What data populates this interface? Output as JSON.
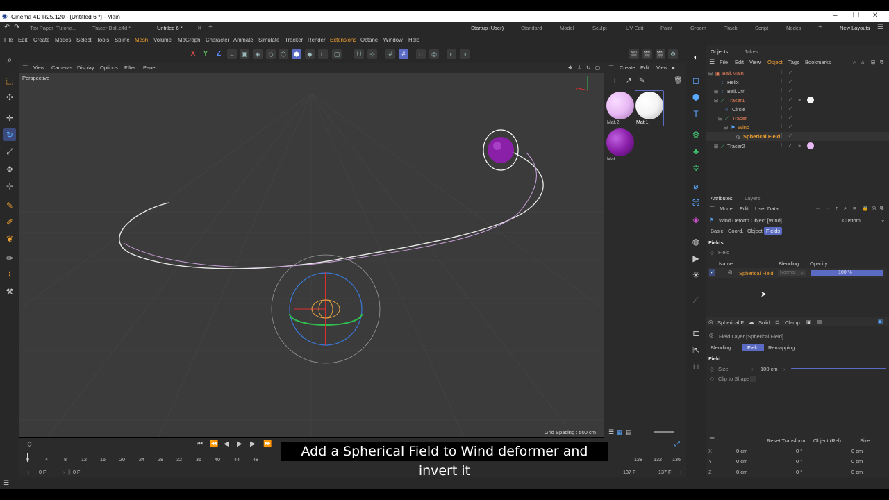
{
  "app": {
    "title": "Cinema 4D R25.120 - [Untitled 6 *] - Main",
    "tabs": [
      "Tax Paper_Tutoria...",
      "Tracer Ball.c4d *",
      "Untitled 6 *"
    ],
    "layouts": [
      "Startup (User)",
      "Standard",
      "Model",
      "Sculpt",
      "UV Edit",
      "Paint",
      "Groom",
      "Track",
      "Script",
      "Nodes"
    ],
    "new_layouts": "New Layouts"
  },
  "menu": [
    "File",
    "Edit",
    "Create",
    "Modes",
    "Select",
    "Tools",
    "Spline",
    "Mesh",
    "Volume",
    "MoGraph",
    "Character",
    "Animate",
    "Simulate",
    "Tracker",
    "Render",
    "Extensions",
    "Octane",
    "Window",
    "Help"
  ],
  "toolbar": {
    "axis_x": "X",
    "axis_y": "Y",
    "axis_z": "Z"
  },
  "viewport": {
    "menu": [
      "View",
      "Cameras",
      "Display",
      "Options",
      "Filter",
      "Panel"
    ],
    "label": "Perspective",
    "grid_spacing": "Grid Spacing : 500 cm"
  },
  "materials": {
    "menu": [
      "Create",
      "Edit",
      "View"
    ],
    "items": [
      {
        "name": "Mat.2",
        "color": "#e8b8f4"
      },
      {
        "name": "Mat.1",
        "color": "#f4f4f4"
      },
      {
        "name": "Mat",
        "color": "#8a1fa8"
      }
    ]
  },
  "objects": {
    "tabs": [
      "Objects",
      "Takes"
    ],
    "menu": [
      "File",
      "Edit",
      "View",
      "Object",
      "Tags",
      "Bookmarks"
    ],
    "rows": [
      {
        "name": "Ball.Main",
        "color": "#e87f5a"
      },
      {
        "name": "Helix",
        "color": "#c8c8c8"
      },
      {
        "name": "Ball.Ctrl",
        "color": "#c8c8c8"
      },
      {
        "name": "Tracer1",
        "color": "#e87f5a"
      },
      {
        "name": "Circle",
        "color": "#c8c8c8"
      },
      {
        "name": "Tracer",
        "color": "#e87f5a"
      },
      {
        "name": "Wind",
        "color": "#f0a030"
      },
      {
        "name": "Spherical Field",
        "color": "#f0a030"
      },
      {
        "name": "Tracer2",
        "color": "#c8c8c8"
      }
    ]
  },
  "attributes": {
    "tabs": [
      "Attributes",
      "Layers"
    ],
    "menu": [
      "Mode",
      "Edit",
      "User Data"
    ],
    "object_title": "Wind Deform Object [Wind]",
    "preset": "Custom",
    "subtabs": [
      "Basic",
      "Coord.",
      "Object",
      "Fields"
    ],
    "section": "Fields",
    "subsection": "Field",
    "columns": [
      "Name",
      "Blending",
      "Opacity"
    ],
    "field_row": {
      "name": "Spherical Field",
      "blending": "Normal",
      "opacity": "100 %"
    },
    "layer_tabs": [
      "Spherical F...",
      "Solid",
      "Clamp"
    ],
    "layer_title": "Field Layer [Spherical Field]",
    "layer_subtabs": [
      "Blending",
      "Field",
      "Remapping"
    ],
    "field_section": "Field",
    "size_label": "Size",
    "size_value": "100 cm",
    "clip_label": "Clip to Shape"
  },
  "coords": {
    "buttons": [
      "Reset Transform",
      "Object (Rel)",
      "Size"
    ],
    "rows": [
      {
        "axis": "X",
        "pos": "0 cm",
        "rot": "0 °",
        "size": "0 cm"
      },
      {
        "axis": "Y",
        "pos": "0 cm",
        "rot": "0 °",
        "size": "0 cm"
      },
      {
        "axis": "Z",
        "pos": "0 cm",
        "rot": "0 °",
        "size": "0 cm"
      }
    ]
  },
  "timeline": {
    "ticks": [
      "0",
      "4",
      "8",
      "12",
      "16",
      "20",
      "24",
      "28",
      "32",
      "36",
      "40",
      "44",
      "48",
      "128",
      "132",
      "136"
    ],
    "start": "0 F",
    "current": "0 F",
    "end": "137 F",
    "end2": "137 F"
  },
  "subtitle": "Add a Spherical Field to Wind deformer and invert it"
}
